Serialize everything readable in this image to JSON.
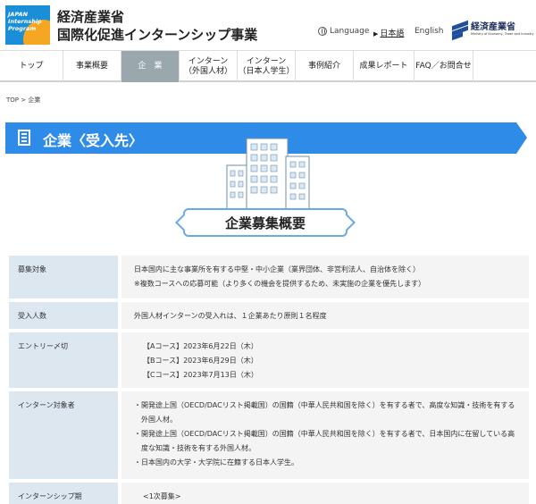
{
  "header": {
    "logo_lines": [
      "JAPAN",
      "Internship",
      "Program"
    ],
    "title_line1": "経済産業省",
    "title_line2": "国際化促進インターンシップ事業",
    "language_label": "Language",
    "lang_japanese": "日本語",
    "lang_english": "English",
    "ministry_name": "経済産業省",
    "ministry_sub": "Ministry of Economy, Trade and Industry"
  },
  "nav": {
    "items": [
      {
        "label": "トップ"
      },
      {
        "label": "事業概要"
      },
      {
        "label": "企　業"
      },
      {
        "label": "インターン\n（外国人材）"
      },
      {
        "label": "インターン\n（日本人学生）"
      },
      {
        "label": "事例紹介"
      },
      {
        "label": "成果レポート"
      },
      {
        "label": "FAQ／お問合せ"
      }
    ]
  },
  "breadcrumb": "TOP > 企業",
  "banner_title": "企業〈受入先〉",
  "overview_title": "企業募集概要",
  "table": {
    "rows": [
      {
        "label": "募集対象",
        "lines": [
          "日本国内に主な事業所を有する中堅・中小企業（業界団体、非営利法人、自治体を除く）",
          "※複数コースへの応募可能（より多くの機会を提供するため、未実施の企業を優先します）"
        ]
      },
      {
        "label": "受入人数",
        "lines": [
          "外国人材インターンの受入れは、１企業あたり原則１名程度"
        ]
      },
      {
        "label": "エントリー〆切",
        "lines": [
          "【Aコース】2023年6月22日（木）",
          "【Bコース】2023年6月29日（木）",
          "【Cコース】2023年7月13日（木）"
        ]
      },
      {
        "label": "インターン対象者",
        "lines": [
          "・開発途上国（OECD/DACリスト掲載国）の国籍（中華人民共和国を除く）を有する者で、高度な知識・技術を有する外国人材。",
          "・開発途上国（OECD/DACリスト掲載国）の国籍（中華人民共和国を除く）を有する者で、日本国内に在留している高度な知識・技術を有する外国人材。",
          "・日本国内の大学・大学院に在籍する日本人学生。"
        ]
      },
      {
        "label": "インターンシップ期",
        "lines": [
          "<1次募集>"
        ]
      }
    ]
  },
  "colors": {
    "banner": "#2f8be8",
    "nav_active": "#9aa7ad",
    "table_header": "#dde7f0",
    "table_cell": "#f4f4f4"
  }
}
